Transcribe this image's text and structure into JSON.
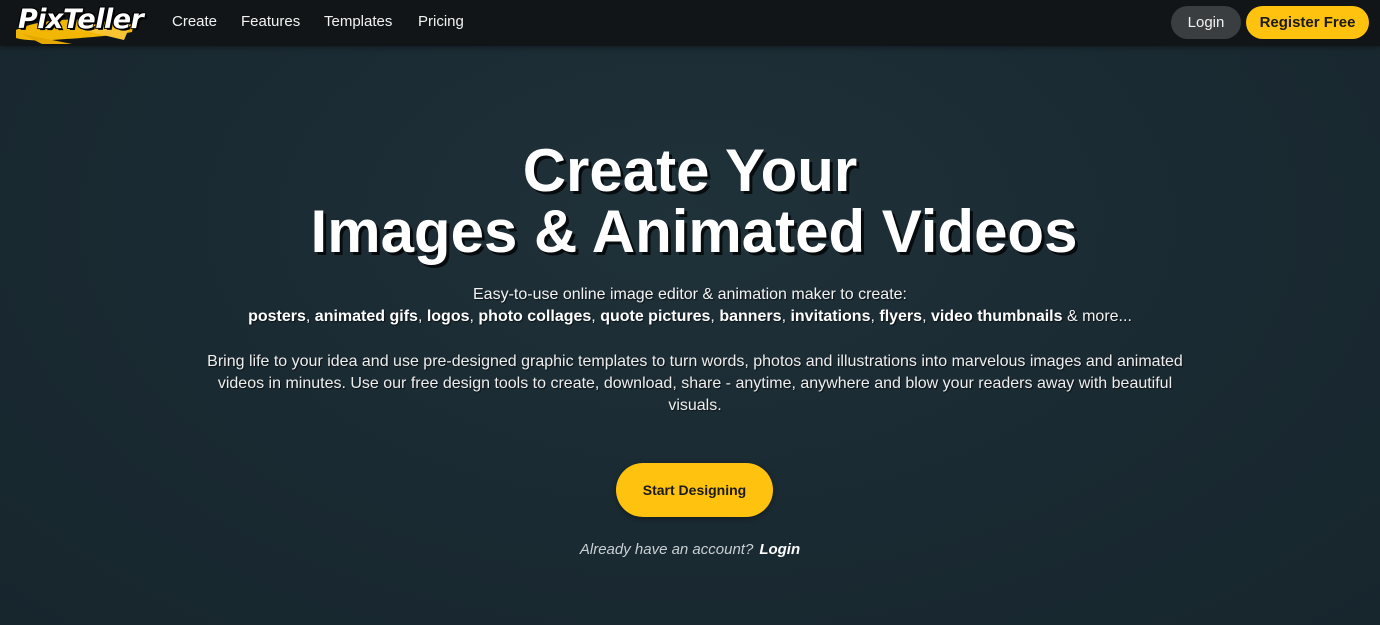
{
  "brand": {
    "logo_text": "PixTeller",
    "accent_color": "#ffc20e",
    "nav_bg": "#111517",
    "page_bg": "#1b2b33"
  },
  "nav": {
    "links": [
      "Create",
      "Features",
      "Templates",
      "Pricing"
    ],
    "login_label": "Login",
    "register_label": "Register Free"
  },
  "hero": {
    "title_line1": "Create Your",
    "title_line2": "Images & Animated Videos",
    "lead": "Easy-to-use online image editor & animation maker to create:",
    "content_types": [
      "posters",
      "animated gifs",
      "logos",
      "photo collages",
      "quote pictures",
      "banners",
      "invitations",
      "flyers",
      "video thumbnails"
    ],
    "content_types_suffix": "& more...",
    "description": "Bring life to your idea and use pre-designed graphic templates to turn words, photos and illustrations into marvelous images and animated videos in minutes. Use our free design tools to create, download, share - anytime, anywhere and blow your readers away with beautiful visuals.",
    "cta_label": "Start Designing",
    "account_question": "Already have an account?",
    "account_login": "Login"
  }
}
